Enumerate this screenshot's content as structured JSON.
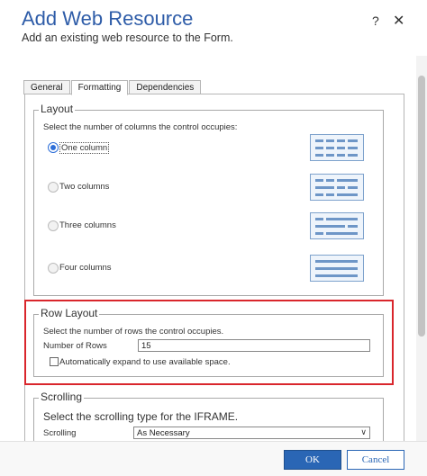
{
  "dialog": {
    "title": "Add Web Resource",
    "subtitle": "Add an existing web resource to the Form.",
    "help_label": "?",
    "close_label": "✕"
  },
  "tabs": [
    {
      "label": "General",
      "active": false
    },
    {
      "label": "Formatting",
      "active": true
    },
    {
      "label": "Dependencies",
      "active": false
    }
  ],
  "layout": {
    "legend": "Layout",
    "instruction": "Select the number of columns the control occupies:",
    "options": [
      {
        "label": "One column",
        "selected": true
      },
      {
        "label": "Two columns",
        "selected": false
      },
      {
        "label": "Three columns",
        "selected": false
      },
      {
        "label": "Four columns",
        "selected": false
      }
    ]
  },
  "row_layout": {
    "legend": "Row Layout",
    "instruction": "Select the number of rows the control occupies.",
    "rows_label": "Number of Rows",
    "rows_value": "15",
    "auto_expand_label": "Automatically expand to use available space.",
    "auto_expand_checked": false
  },
  "scrolling": {
    "legend": "Scrolling",
    "instruction": "Select the scrolling type for the IFRAME.",
    "label": "Scrolling",
    "value": "As Necessary"
  },
  "footer": {
    "ok_label": "OK",
    "cancel_label": "Cancel"
  },
  "colors": {
    "title": "#2e5ca8",
    "highlight": "#d9262c",
    "primary_button": "#2a66b5"
  },
  "icons": {
    "help": "question-mark-icon",
    "close": "close-icon",
    "dropdown": "chevron-down-icon"
  }
}
